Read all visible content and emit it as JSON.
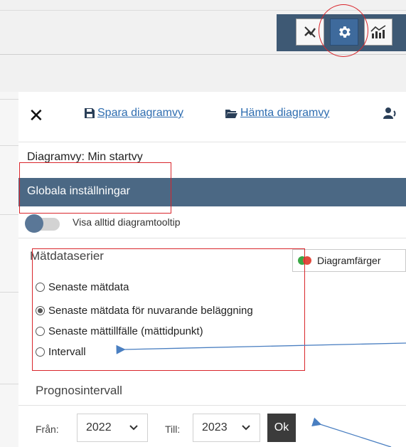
{
  "toolbar": {
    "buttons": [
      {
        "icon": "no-tooltip-icon",
        "active": false
      },
      {
        "icon": "gear-icon",
        "active": true
      },
      {
        "icon": "chart-icon",
        "active": false
      }
    ]
  },
  "panel": {
    "close_icon": "close-icon",
    "save_view": "Spara diagramvy",
    "load_view": "Hämta diagramvy",
    "print_icon": "print-icon",
    "view_name": "Diagramvy: Min startvy",
    "section_title": "Globala inställningar",
    "tooltip_toggle": {
      "label": "Visa alltid diagramtooltip",
      "on": false
    },
    "series": {
      "title": "Mätdataserier",
      "colors_button": "Diagramfärger",
      "options": [
        {
          "label": "Senaste mätdata",
          "checked": false
        },
        {
          "label": "Senaste mätdata för nuvarande beläggning",
          "checked": true
        },
        {
          "label": "Senaste mättillfälle (mättidpunkt)",
          "checked": false
        },
        {
          "label": "Intervall",
          "checked": false
        }
      ]
    },
    "forecast": {
      "title": "Prognosintervall",
      "from_label": "Från:",
      "from_value": "2022",
      "to_label": "Till:",
      "to_value": "2023",
      "ok_label": "Ok"
    }
  },
  "colors": {
    "header_bar": "#4b6884",
    "toolbar_bg": "#3e5974",
    "highlight": "#d9262c",
    "link": "#2e6db0",
    "arrow": "#4a7fc1"
  }
}
